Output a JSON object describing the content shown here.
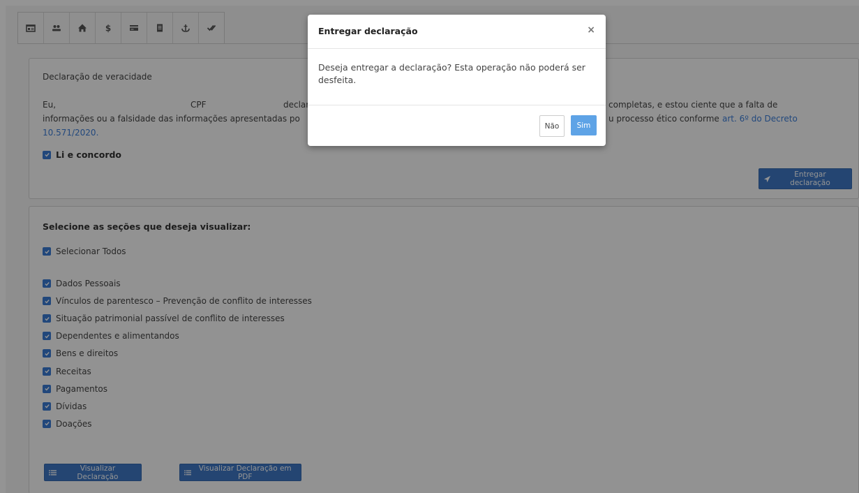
{
  "toolbar": {
    "icons": [
      "id-card-icon",
      "users-icon",
      "home-icon",
      "dollar-icon",
      "credit-card-icon",
      "document-icon",
      "anchor-icon",
      "double-check-icon"
    ]
  },
  "declaration": {
    "title": "Declaração de veracidade",
    "line1_a": "Eu,",
    "line1_b": "CPF",
    "line1_c": "declar",
    "line1_d": "completas, e estou ciente que a falta de",
    "line2_a": "informações ou a falsidade das informações apresentadas po",
    "line2_b": "u processo ético conforme",
    "line2_link": "art. 6º do Decreto",
    "line3_link": "10.571/2020.",
    "agree_label": "Li e concordo",
    "deliver_button": "Entregar declaração"
  },
  "sections": {
    "title": "Selecione as seções que deseja visualizar:",
    "select_all": "Selecionar Todos",
    "items": [
      "Dados Pessoais",
      "Vínculos de parentesco – Prevenção de conflito de interesses",
      "Situação patrimonial passível de conflito de interesses",
      "Dependentes e alimentandos",
      "Bens e direitos",
      "Receitas",
      "Pagamentos",
      "Dívidas",
      "Doações"
    ],
    "view_button": "Visualizar Declaração",
    "pdf_button": "Visualizar Declaração em PDF"
  },
  "modal": {
    "title": "Entregar declaração",
    "close": "×",
    "body": "Deseja entregar a declaração? Esta operação não poderá ser desfeita.",
    "no_button": "Não",
    "yes_button": "Sim"
  },
  "colors": {
    "primary": "#3f78c4",
    "checkbox": "#3a7bd5",
    "link": "#3b7dd8",
    "yes_button": "#5ea3e6"
  }
}
